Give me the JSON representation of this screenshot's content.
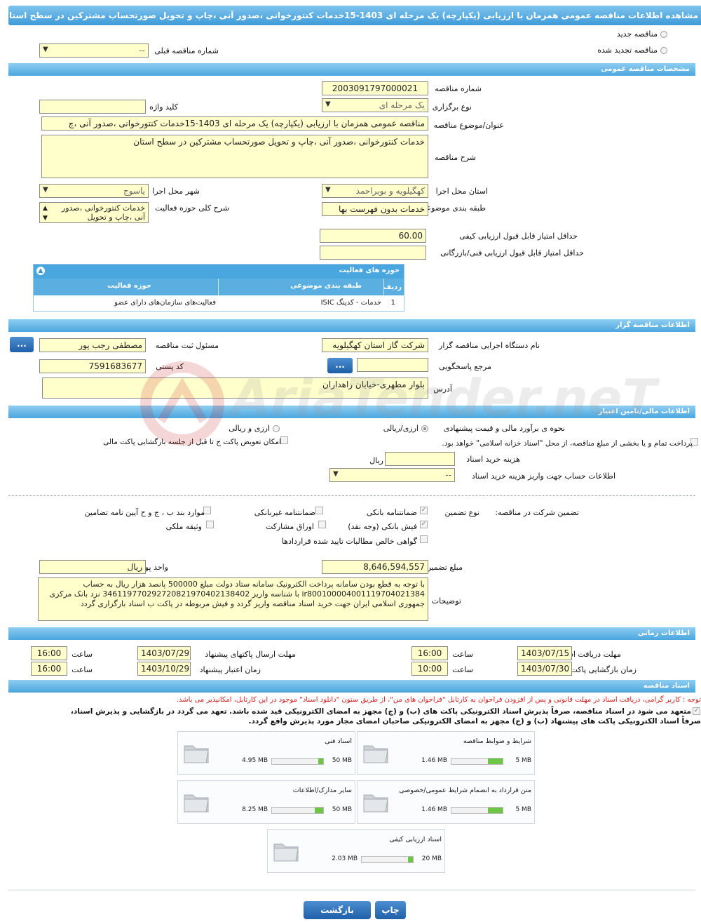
{
  "page": {
    "title": "مشاهده اطلاعات مناقصه عمومی همزمان با ارزیابی (یکپارچه) یک مرحله ای 1403-15خدمات کنتورخوانی ،صدور آنی ،چاپ و تحویل صورتحساب مشترکین در سطح استان"
  },
  "top": {
    "new_tender": "مناقصه جدید",
    "renewed_tender": "مناقصه تجدید شده",
    "prev_tender_label": "شماره مناقصه قبلی",
    "prev_tender_value": "--"
  },
  "general": {
    "header": "مشخصات مناقصه عمومی",
    "tender_no_label": "شماره مناقصه",
    "tender_no": "2003091797000021",
    "type_label": "نوع برگزاری",
    "type_value": "یک مرحله ای",
    "keyword_label": "کلید واژه",
    "keyword_value": "",
    "subject_label": "عنوان/موضوع مناقصه",
    "subject_value": "مناقصه عمومی همزمان با ارزیابی (یکپارچه) یک مرحله ای 1403-15خدمات کنتورخوانی ،صدور آنی ،چ",
    "desc_label": "شرح مناقصه",
    "desc_value": "خدمات کنتورخوانی ،صدور آنی ،چاپ و تحویل صورتحساب مشترکین در سطح استان",
    "province_label": "استان محل اجرا",
    "province_value": "کهگیلویه و بویراحمد",
    "city_label": "شهر محل اجرا",
    "city_value": "یاسوج",
    "category_label": "طبقه بندی موضوعی",
    "category_value": "خدمات بدون فهرست بها",
    "activity_label": "شرح کلی حوزه فعالیت",
    "activity_value": "خدمات کنتورخوانی ،صدور آنی ،چاپ و تحویل",
    "min_quality_label": "حداقل امتیاز قابل قبول ارزیابی کیفی",
    "min_quality_value": "60.00",
    "min_tech_label": "حداقل امتیاز قابل قبول ارزیابی فنی/بازرگانی",
    "min_tech_value": ""
  },
  "activity_grid": {
    "title": "حوزه های فعالیت",
    "columns": [
      "ردیف",
      "طبقه بندی موضوعی",
      "حوزه فعالیت"
    ],
    "rows": [
      [
        "1",
        "خدمات - کدینگ ISIC",
        "فعالیت‌های سازمان‌های دارای عضو"
      ]
    ]
  },
  "organizer": {
    "header": "اطلاعات مناقصه گزار",
    "org_label": "نام دستگاه اجرایی مناقصه گزار",
    "org_value": "شرکت گاز استان کهگیلویه",
    "registrar_label": "مسئول ثبت مناقصه",
    "registrar_value": "مصطفی رجب پور",
    "ref_label": "مرجع پاسخگویی",
    "ref_value": "",
    "postal_label": "کد پستی",
    "postal_value": "7591683677",
    "address_label": "آدرس",
    "address_value": "بلوار مطهری-خیابان راهداران",
    "dots": "..."
  },
  "finance": {
    "header": "اطلاعات مالی/تامین اعتبار",
    "estimate_label": "نحوه ی برآورد مالی و قیمت پیشنهادی",
    "rial_fx": "ارزی/ریالی",
    "fx_rial": "ارزی و ریالی",
    "treasury_text": "پرداخت تمام و یا بخشی از مبلغ مناقصه، از محل \"اسناد خزانه اسلامی\" خواهد بود.",
    "swap_text": "امکان تعویض پاکت ج تا قبل از جلسه بازگشایی پاکت مالی",
    "doc_cost_label": "هزینه خرید اسناد",
    "doc_cost_value": "",
    "rial": "ریال",
    "account_label": "اطلاعات حساب جهت واریز هزینه خرید اسناد",
    "account_value": "--"
  },
  "guarantee": {
    "participation_label": "تضمین شرکت در مناقصه:",
    "type_label": "نوع تضمین",
    "bank_guarantee": "ضمانتنامه بانکی",
    "nonbank_guarantee": "ضمانتنامه غیربانکی",
    "items_bpj": "موارد بند ب ، ج و ح آیین نامه تضامین",
    "bank_receipt": "فیش بانکی (وجه نقد)",
    "bonds": "اوراق مشارکت",
    "property": "وثیقه ملکی",
    "claims": "گواهی خالص مطالبات تایید شده قراردادها",
    "amount_label": "مبلغ تضمین",
    "amount_value": "8,646,594,557",
    "currency_label": "واحد پول",
    "currency_value": "ریال",
    "notes_label": "توضیحات",
    "notes_lines": [
      "با توجه به قطع بودن سامانه پرداخت الکترونیک سامانه ستاد دولت مبلغ 500000 پانصد هزار ریال به حساب",
      "ir800100004001119704021384  با شناسه واریز 346119770292720821970402138402 نزد بانک مرکزی",
      "جمهوری اسلامی ایران جهت خرید اسناد مناقصه واریز گردد و فیش مربوطه در پاکت ب اسناد بارگزاری گردد"
    ]
  },
  "timing": {
    "header": "اطلاعات زمانی",
    "receive_label": "مهلت دریافت اسناد",
    "receive_date": "1403/07/15",
    "receive_time": "16:00",
    "submit_label": "مهلت ارسال پاکتهای پیشنهاد",
    "submit_date": "1403/07/29",
    "submit_time": "16:00",
    "open_label": "زمان بازگشایی پاکت ها",
    "open_date": "1403/07/30",
    "open_time": "10:00",
    "validity_label": "زمان اعتبار پیشنهاد",
    "validity_date": "1403/10/29",
    "validity_time": "16:00",
    "time_label": "ساعت"
  },
  "documents": {
    "header": "اسناد مناقصه",
    "notice": "توجه : کاربر گرامی، دریافت اسناد در مهلت قانونی و پس از افزودن فراخوان به کارتابل \"فراخوان های من\"، از طریق ستون \"دانلود اسناد\" موجود در این کارتابل، امکانپذیر می باشد.",
    "commit_line1": "متعهد می شود در اسناد مناقصه، صرفاً پذیرش اسناد الکترونیکی پاکت های (ب) و (ج) مجهز به امضای الکترونیکی قید شده باشد. تعهد می گردد در بازگشایی و پذیرش اسناد،",
    "commit_line2": "صرفاً اسناد الکترونیکی پاکت های پیشنهاد (ب) و (ج) مجهز به امضای الکترونیکی صاحبان امضای مجاز مورد پذیرش واقع گردد.",
    "cards": [
      {
        "name": "شرایط و ضوابط مناقصه",
        "used": "1.46 MB",
        "max": "5 MB",
        "fill": 0.29
      },
      {
        "name": "اسناد فنی",
        "used": "4.95 MB",
        "max": "50 MB",
        "fill": 0.1
      },
      {
        "name": "متن قرارداد به انضمام شرایط عمومی/خصوصی",
        "used": "1.46 MB",
        "max": "5 MB",
        "fill": 0.29
      },
      {
        "name": "سایر مدارک/اطلاعات",
        "used": "8.25 MB",
        "max": "50 MB",
        "fill": 0.17
      },
      {
        "name": "اسناد ارزیابی کیفی",
        "used": "2.03 MB",
        "max": "20 MB",
        "fill": 0.1
      }
    ]
  },
  "footer": {
    "print": "چاپ",
    "back": "بازگشت"
  },
  "watermark": {
    "text": "AriaTender.neT"
  }
}
